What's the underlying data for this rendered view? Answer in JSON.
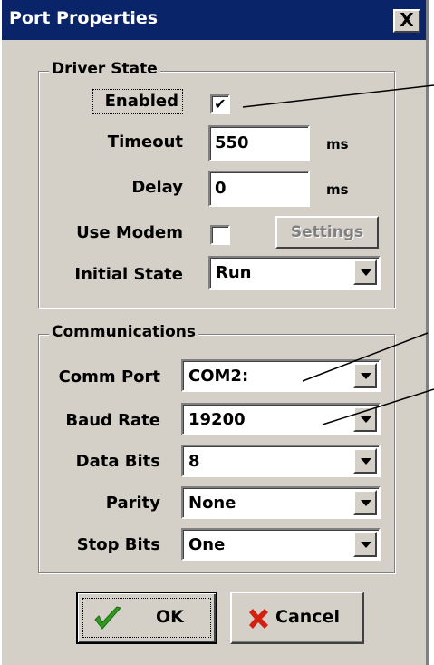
{
  "window": {
    "title": "Port Properties",
    "close_glyph": "X"
  },
  "driver_state": {
    "legend": "Driver State",
    "enabled": {
      "label": "Enabled",
      "checked": true,
      "check_glyph": "✔"
    },
    "timeout": {
      "label": "Timeout",
      "value": "550",
      "unit": "ms"
    },
    "delay": {
      "label": "Delay",
      "value": "0",
      "unit": "ms"
    },
    "use_modem": {
      "label": "Use Modem",
      "checked": false,
      "settings_label": "Settings"
    },
    "initial_state": {
      "label": "Initial State",
      "value": "Run"
    }
  },
  "communications": {
    "legend": "Communications",
    "comm_port": {
      "label": "Comm Port",
      "value": "COM2:"
    },
    "baud_rate": {
      "label": "Baud Rate",
      "value": "19200"
    },
    "data_bits": {
      "label": "Data Bits",
      "value": "8"
    },
    "parity": {
      "label": "Parity",
      "value": "None"
    },
    "stop_bits": {
      "label": "Stop Bits",
      "value": "One"
    }
  },
  "buttons": {
    "ok": "OK",
    "cancel": "Cancel"
  },
  "colors": {
    "titlebar": "#0a246a",
    "face": "#d4d0c8",
    "ok_check": "#2e9a1e",
    "cancel_x": "#d42010"
  }
}
